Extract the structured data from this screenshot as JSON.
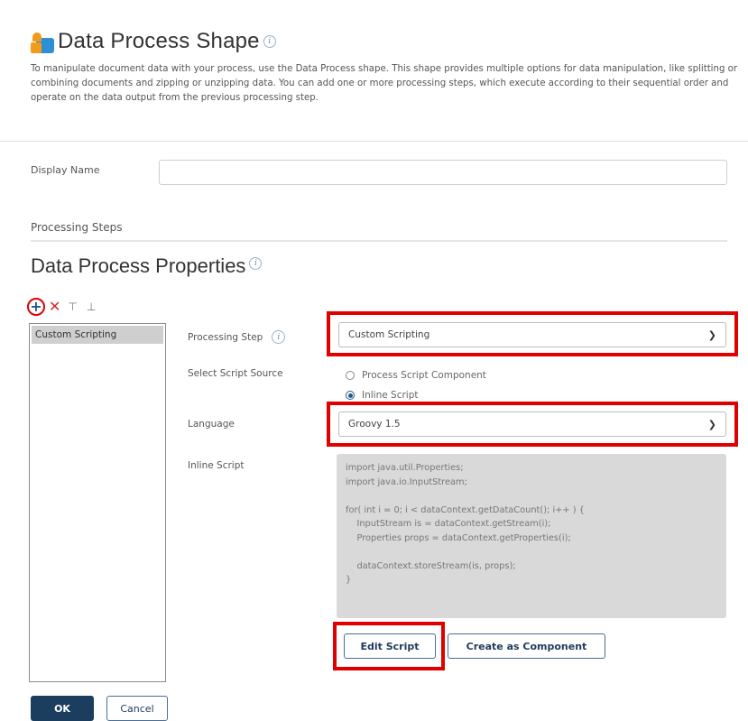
{
  "header": {
    "title": "Data Process Shape",
    "info_icon": "i",
    "description": "To manipulate document data with your process, use the Data Process shape. This shape provides multiple options for data manipulation, like splitting or combining documents and zipping or unzipping data. You can add one or more processing steps, which execute according to their sequential order and operate on the data output from the previous processing step."
  },
  "display_name": {
    "label": "Display Name",
    "value": "",
    "placeholder": ""
  },
  "processing_steps_label": "Processing Steps",
  "properties": {
    "title": "Data Process Properties",
    "info_icon": "i"
  },
  "toolbar": {
    "add_icon": "+",
    "delete_icon": "✕",
    "move_top_icon": "⊤",
    "move_bottom_icon": "⊥"
  },
  "steps": [
    {
      "label": "Custom Scripting",
      "selected": true
    }
  ],
  "form": {
    "processing_step_label": "Processing Step",
    "processing_step_value": "Custom Scripting",
    "script_source_label": "Select Script Source",
    "script_source_options": [
      {
        "label": "Process Script Component",
        "checked": false
      },
      {
        "label": "Inline Script",
        "checked": true
      }
    ],
    "language_label": "Language",
    "language_value": "Groovy 1.5",
    "inline_script_label": "Inline Script",
    "inline_script": "import java.util.Properties;\nimport java.io.InputStream;\n\nfor( int i = 0; i < dataContext.getDataCount(); i++ ) {\n    InputStream is = dataContext.getStream(i);\n    Properties props = dataContext.getProperties(i);\n\n    dataContext.storeStream(is, props);\n}",
    "edit_script_label": "Edit Script",
    "create_component_label": "Create as Component"
  },
  "footer": {
    "ok_label": "OK",
    "cancel_label": "Cancel"
  },
  "colors": {
    "highlight": "#e00000",
    "primary": "#1b3e5e",
    "delete": "#d9262b"
  }
}
